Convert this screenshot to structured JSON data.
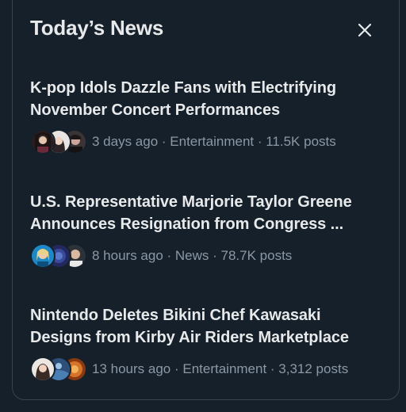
{
  "panel": {
    "title": "Today’s News",
    "close_icon": "close-icon"
  },
  "news": [
    {
      "headline_line1": "K-pop Idols Dazzle Fans with Electrifying",
      "headline_line2": "November Concert Performances",
      "meta": "3 days ago · Entertainment · 11.5K posts"
    },
    {
      "headline_line1": "U.S. Representative Marjorie Taylor Greene",
      "headline_line2": "Announces Resignation from Congress ...",
      "meta": "8 hours ago · News · 78.7K posts"
    },
    {
      "headline_line1": "Nintendo Deletes Bikini Chef Kawasaki",
      "headline_line2": "Designs from Kirby Air Riders Marketplace",
      "meta": "13 hours ago · Entertainment · 3,312 posts"
    }
  ],
  "colors": {
    "background": "#15202b",
    "border": "#38444d",
    "text_primary": "#e7e9ea",
    "text_secondary": "#8b98a5"
  }
}
